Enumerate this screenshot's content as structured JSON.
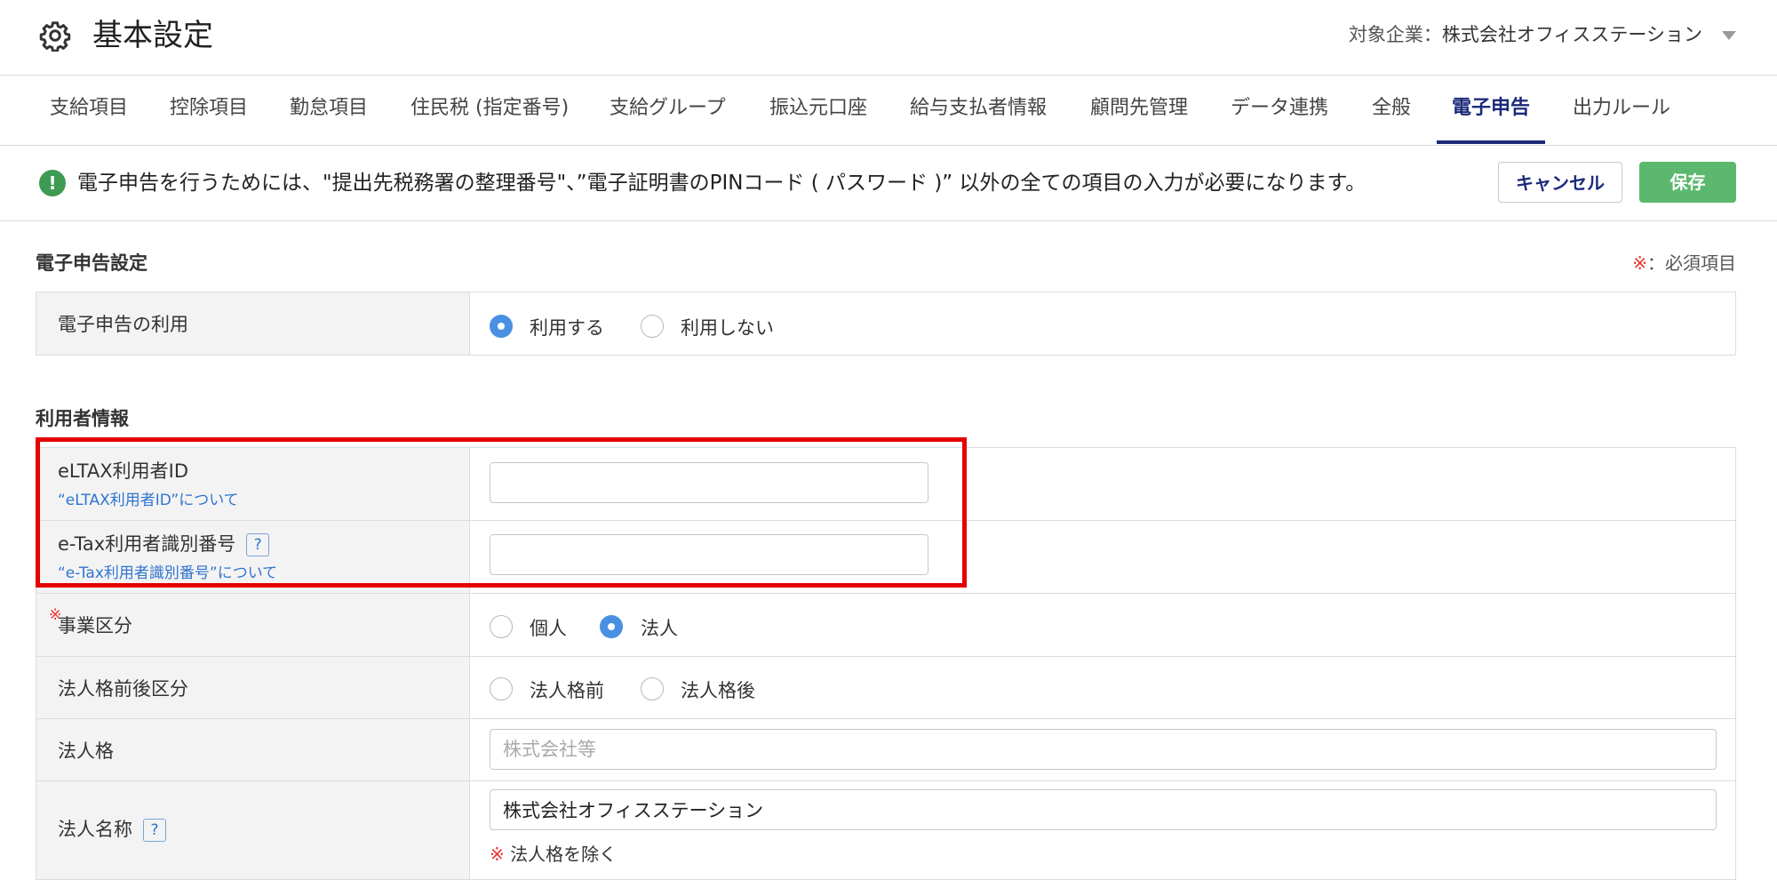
{
  "header": {
    "title": "基本設定",
    "company_label": "対象企業：",
    "company_name": "株式会社オフィスステーション"
  },
  "tabs": [
    {
      "label": "支給項目"
    },
    {
      "label": "控除項目"
    },
    {
      "label": "勤怠項目"
    },
    {
      "label": "住民税 (指定番号)"
    },
    {
      "label": "支給グループ"
    },
    {
      "label": "振込元口座"
    },
    {
      "label": "給与支払者情報"
    },
    {
      "label": "顧問先管理"
    },
    {
      "label": "データ連携"
    },
    {
      "label": "全般"
    },
    {
      "label": "電子申告",
      "active": true
    },
    {
      "label": "出力ルール"
    }
  ],
  "notice": {
    "text": "電子申告を行うためには、\"提出先税務署の整理番号\"、”電子証明書のPINコード ( パスワード )” 以外の全ての項目の入力が必要になります。",
    "cancel_label": "キャンセル",
    "save_label": "保存"
  },
  "section1": {
    "title": "電子申告設定",
    "required_mark": "※",
    "required_text": "：必須項目",
    "use_row": {
      "label": "電子申告の利用",
      "options": [
        "利用する",
        "利用しない"
      ],
      "selected": "利用する"
    }
  },
  "section2": {
    "title": "利用者情報",
    "eltax": {
      "label": "eLTAX利用者ID",
      "help": "“eLTAX利用者ID”について",
      "value": ""
    },
    "etax": {
      "label": "e-Tax利用者識別番号",
      "help": "“e-Tax利用者識別番号”について",
      "value": ""
    },
    "business": {
      "required_mark": "※",
      "label": "事業区分",
      "options": [
        "個人",
        "法人"
      ],
      "selected": "法人"
    },
    "corp_position": {
      "label": "法人格前後区分",
      "options": [
        "法人格前",
        "法人格後"
      ],
      "selected": ""
    },
    "corp_type": {
      "label": "法人格",
      "placeholder": "株式会社等",
      "value": ""
    },
    "corp_name": {
      "label": "法人名称",
      "value": "株式会社オフィスステーション",
      "note_mark": "※",
      "note": "法人格を除く"
    },
    "help_glyph": "?"
  },
  "colors": {
    "accent": "#1c2a7a",
    "save": "#5cb86e",
    "highlight": "#e50000",
    "link": "#2f74d0",
    "radio": "#4a90e2"
  }
}
